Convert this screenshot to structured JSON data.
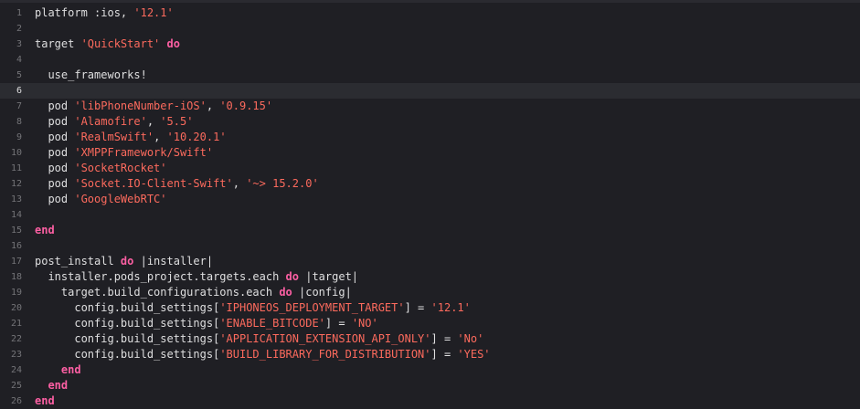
{
  "editor": {
    "language": "ruby",
    "current_line": 6,
    "colors": {
      "background": "#1f1f24",
      "current_line_background": "#2b2c31",
      "gutter_text": "#747478",
      "plain_text": "#dfdfe0",
      "keyword": "#fc5fa3",
      "string": "#fc6a5d"
    },
    "lines": [
      {
        "n": "1",
        "indent": "",
        "tokens": [
          {
            "t": "p",
            "v": "platform :ios, "
          },
          {
            "t": "s",
            "v": "'12.1'"
          }
        ]
      },
      {
        "n": "2",
        "indent": "",
        "tokens": []
      },
      {
        "n": "3",
        "indent": "",
        "tokens": [
          {
            "t": "p",
            "v": "target "
          },
          {
            "t": "s",
            "v": "'QuickStart'"
          },
          {
            "t": "p",
            "v": " "
          },
          {
            "t": "k",
            "v": "do"
          }
        ]
      },
      {
        "n": "4",
        "indent": "",
        "tokens": []
      },
      {
        "n": "5",
        "indent": "  ",
        "tokens": [
          {
            "t": "p",
            "v": "use_frameworks!"
          }
        ]
      },
      {
        "n": "6",
        "indent": "",
        "tokens": []
      },
      {
        "n": "7",
        "indent": "  ",
        "tokens": [
          {
            "t": "p",
            "v": "pod "
          },
          {
            "t": "s",
            "v": "'libPhoneNumber-iOS'"
          },
          {
            "t": "p",
            "v": ", "
          },
          {
            "t": "s",
            "v": "'0.9.15'"
          }
        ]
      },
      {
        "n": "8",
        "indent": "  ",
        "tokens": [
          {
            "t": "p",
            "v": "pod "
          },
          {
            "t": "s",
            "v": "'Alamofire'"
          },
          {
            "t": "p",
            "v": ", "
          },
          {
            "t": "s",
            "v": "'5.5'"
          }
        ]
      },
      {
        "n": "9",
        "indent": "  ",
        "tokens": [
          {
            "t": "p",
            "v": "pod "
          },
          {
            "t": "s",
            "v": "'RealmSwift'"
          },
          {
            "t": "p",
            "v": ", "
          },
          {
            "t": "s",
            "v": "'10.20.1'"
          }
        ]
      },
      {
        "n": "10",
        "indent": "  ",
        "tokens": [
          {
            "t": "p",
            "v": "pod "
          },
          {
            "t": "s",
            "v": "'XMPPFramework/Swift'"
          }
        ]
      },
      {
        "n": "11",
        "indent": "  ",
        "tokens": [
          {
            "t": "p",
            "v": "pod "
          },
          {
            "t": "s",
            "v": "'SocketRocket'"
          }
        ]
      },
      {
        "n": "12",
        "indent": "  ",
        "tokens": [
          {
            "t": "p",
            "v": "pod "
          },
          {
            "t": "s",
            "v": "'Socket.IO-Client-Swift'"
          },
          {
            "t": "p",
            "v": ", "
          },
          {
            "t": "s",
            "v": "'~> 15.2.0'"
          }
        ]
      },
      {
        "n": "13",
        "indent": "  ",
        "tokens": [
          {
            "t": "p",
            "v": "pod "
          },
          {
            "t": "s",
            "v": "'GoogleWebRTC'"
          }
        ]
      },
      {
        "n": "14",
        "indent": "",
        "tokens": []
      },
      {
        "n": "15",
        "indent": "",
        "tokens": [
          {
            "t": "k",
            "v": "end"
          }
        ]
      },
      {
        "n": "16",
        "indent": "",
        "tokens": []
      },
      {
        "n": "17",
        "indent": "",
        "tokens": [
          {
            "t": "p",
            "v": "post_install "
          },
          {
            "t": "k",
            "v": "do"
          },
          {
            "t": "p",
            "v": " |installer|"
          }
        ]
      },
      {
        "n": "18",
        "indent": "  ",
        "tokens": [
          {
            "t": "p",
            "v": "installer.pods_project.targets.each "
          },
          {
            "t": "k",
            "v": "do"
          },
          {
            "t": "p",
            "v": " |target|"
          }
        ]
      },
      {
        "n": "19",
        "indent": "    ",
        "tokens": [
          {
            "t": "p",
            "v": "target.build_configurations.each "
          },
          {
            "t": "k",
            "v": "do"
          },
          {
            "t": "p",
            "v": " |config|"
          }
        ]
      },
      {
        "n": "20",
        "indent": "      ",
        "tokens": [
          {
            "t": "p",
            "v": "config.build_settings["
          },
          {
            "t": "s",
            "v": "'IPHONEOS_DEPLOYMENT_TARGET'"
          },
          {
            "t": "p",
            "v": "] = "
          },
          {
            "t": "s",
            "v": "'12.1'"
          }
        ]
      },
      {
        "n": "21",
        "indent": "      ",
        "tokens": [
          {
            "t": "p",
            "v": "config.build_settings["
          },
          {
            "t": "s",
            "v": "'ENABLE_BITCODE'"
          },
          {
            "t": "p",
            "v": "] = "
          },
          {
            "t": "s",
            "v": "'NO'"
          }
        ]
      },
      {
        "n": "22",
        "indent": "      ",
        "tokens": [
          {
            "t": "p",
            "v": "config.build_settings["
          },
          {
            "t": "s",
            "v": "'APPLICATION_EXTENSION_API_ONLY'"
          },
          {
            "t": "p",
            "v": "] = "
          },
          {
            "t": "s",
            "v": "'No'"
          }
        ]
      },
      {
        "n": "23",
        "indent": "      ",
        "tokens": [
          {
            "t": "p",
            "v": "config.build_settings["
          },
          {
            "t": "s",
            "v": "'BUILD_LIBRARY_FOR_DISTRIBUTION'"
          },
          {
            "t": "p",
            "v": "] = "
          },
          {
            "t": "s",
            "v": "'YES'"
          }
        ]
      },
      {
        "n": "24",
        "indent": "    ",
        "tokens": [
          {
            "t": "k",
            "v": "end"
          }
        ]
      },
      {
        "n": "25",
        "indent": "  ",
        "tokens": [
          {
            "t": "k",
            "v": "end"
          }
        ]
      },
      {
        "n": "26",
        "indent": "",
        "tokens": [
          {
            "t": "k",
            "v": "end"
          }
        ]
      }
    ]
  }
}
